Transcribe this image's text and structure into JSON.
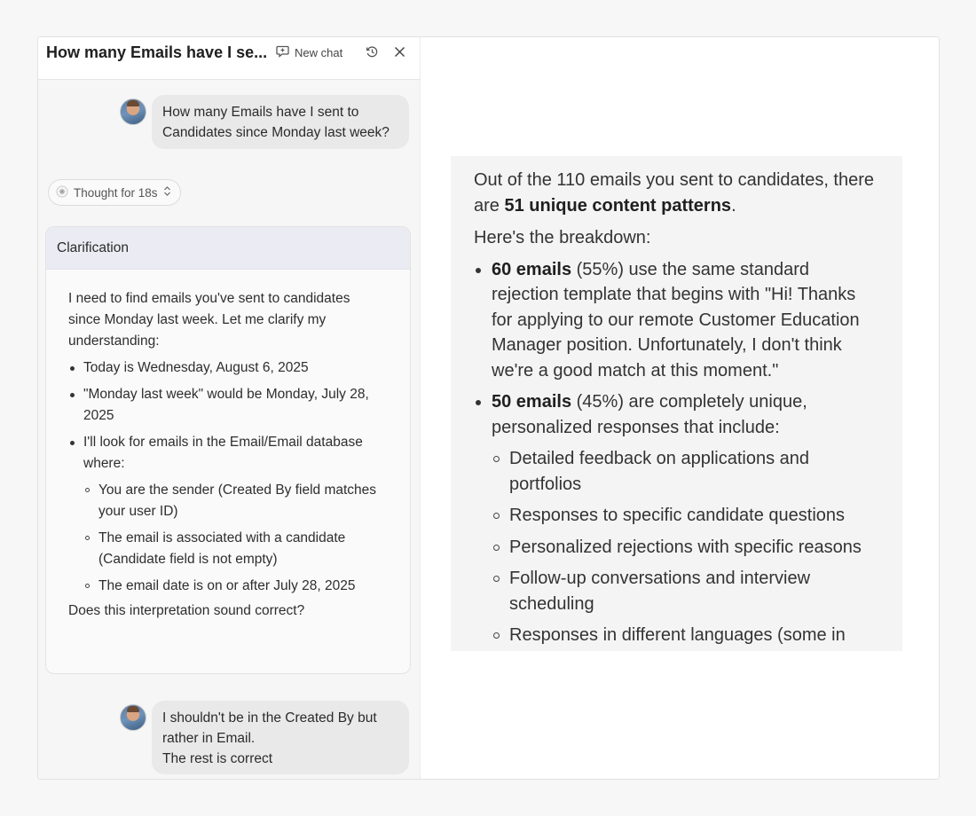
{
  "chat": {
    "title": "How many Emails have I se...",
    "new_chat_label": "New chat",
    "icons": {
      "new_chat": "new-chat-icon",
      "history": "history-icon",
      "close": "close-icon"
    }
  },
  "messages": {
    "user_1": "How many Emails have I sent to Candidates since Monday last week?",
    "thought_label": "Thought for 18s",
    "clarification": {
      "title": "Clarification",
      "intro": "I need to find emails you've sent to candidates since Monday last week. Let me clarify my understanding:",
      "bullets": [
        "Today is Wednesday, August 6, 2025",
        "\"Monday last week\" would be Monday, July 28, 2025",
        "I'll look for emails in the Email/Email database where:"
      ],
      "sub_bullets": [
        "You are the sender (Created By field matches your user ID)",
        "The email is associated with a candidate (Candidate field is not empty)",
        "The email date is on or after July 28, 2025"
      ],
      "closing": "Does this interpretation sound correct?"
    },
    "user_2_line_1": "I shouldn't be in the Created By but rather in Email.",
    "user_2_line_2": "The rest is correct"
  },
  "answer": {
    "intro_prefix": "Out of the 110 emails you sent to candidates, there are ",
    "intro_bold": "51 unique content patterns",
    "intro_suffix": ".",
    "breakdown_label": "Here's the breakdown:",
    "item_1_bold": "60 emails",
    "item_1_text": " (55%) use the same standard rejection template that begins with \"Hi! Thanks for applying to our remote Customer Education Manager position. Unfortunately, I don't think we're a good match at this moment.\"",
    "item_2_bold": "50 emails",
    "item_2_text": " (45%) are completely unique, personalized responses that include:",
    "sub_items": [
      "Detailed feedback on applications and portfolios",
      "Responses to specific candidate questions",
      "Personalized rejections with specific reasons",
      "Follow-up conversations and interview scheduling",
      "Responses in different languages (some in Russian)"
    ]
  }
}
